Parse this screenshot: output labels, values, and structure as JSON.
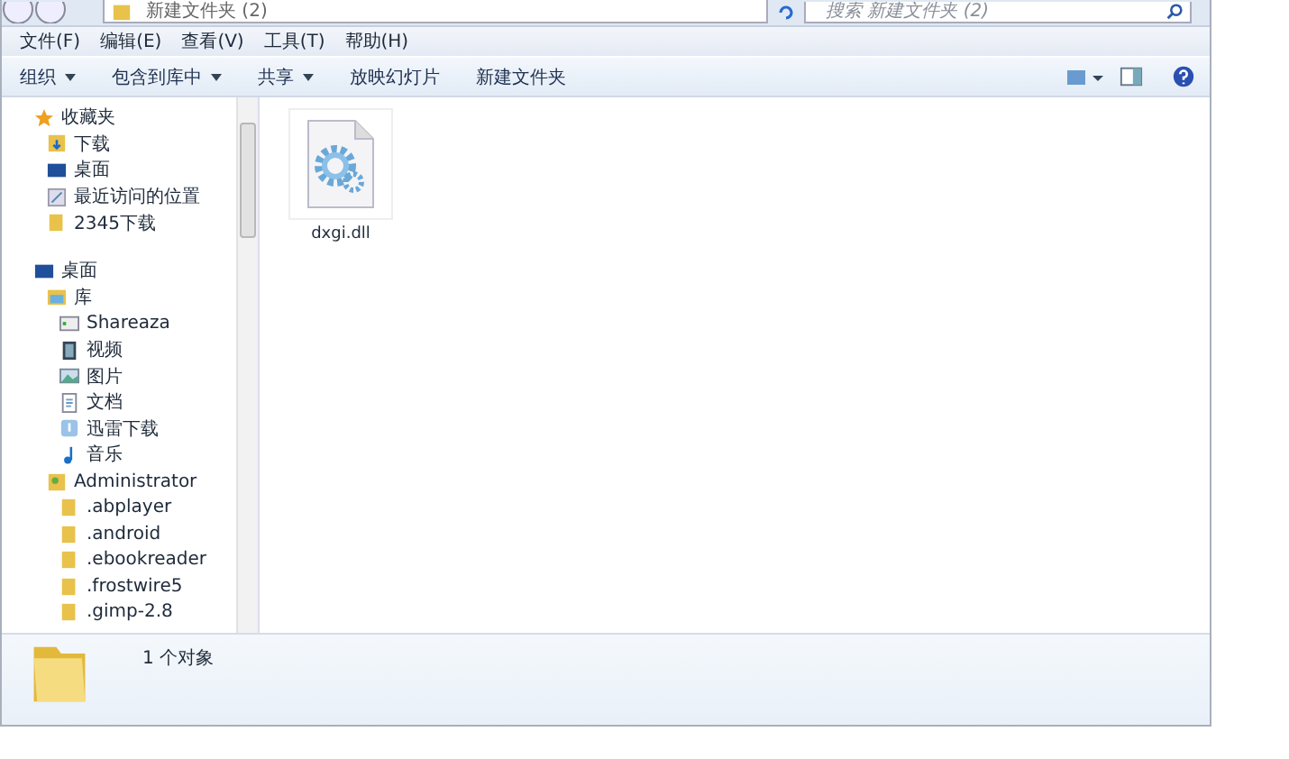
{
  "address_bar": {
    "path": "新建文件夹 (2)"
  },
  "search": {
    "placeholder": "搜索 新建文件夹 (2)"
  },
  "menu": [
    "文件(F)",
    "编辑(E)",
    "查看(V)",
    "工具(T)",
    "帮助(H)"
  ],
  "toolbar": [
    {
      "label": "组织",
      "dropdown": true
    },
    {
      "label": "包含到库中",
      "dropdown": true
    },
    {
      "label": "共享",
      "dropdown": true
    },
    {
      "label": "放映幻灯片",
      "dropdown": false
    },
    {
      "label": "新建文件夹",
      "dropdown": false
    }
  ],
  "sidebar": {
    "groups": [
      {
        "label": "收藏夹",
        "kind": "star",
        "children": [
          {
            "label": "下载",
            "kind": "download"
          },
          {
            "label": "桌面",
            "kind": "desktop"
          },
          {
            "label": "最近访问的位置",
            "kind": "recent"
          },
          {
            "label": "2345下载",
            "kind": "folder"
          }
        ]
      },
      {
        "label": "桌面",
        "kind": "desktop",
        "children": [
          {
            "label": "库",
            "kind": "library",
            "children": [
              {
                "label": "Shareaza",
                "kind": "app"
              },
              {
                "label": "视频",
                "kind": "video"
              },
              {
                "label": "图片",
                "kind": "picture"
              },
              {
                "label": "文档",
                "kind": "document"
              },
              {
                "label": "迅雷下载",
                "kind": "thunder"
              },
              {
                "label": "音乐",
                "kind": "music"
              }
            ]
          },
          {
            "label": "Administrator",
            "kind": "user",
            "children": [
              {
                "label": ".abplayer",
                "kind": "folder"
              },
              {
                "label": ".android",
                "kind": "folder"
              },
              {
                "label": ".ebookreader",
                "kind": "folder"
              },
              {
                "label": ".frostwire5",
                "kind": "folder"
              },
              {
                "label": ".gimp-2.8",
                "kind": "folder"
              }
            ]
          }
        ]
      }
    ]
  },
  "files": [
    {
      "name": "dxgi.dll"
    }
  ],
  "status_bar": {
    "text": "1 个对象"
  }
}
